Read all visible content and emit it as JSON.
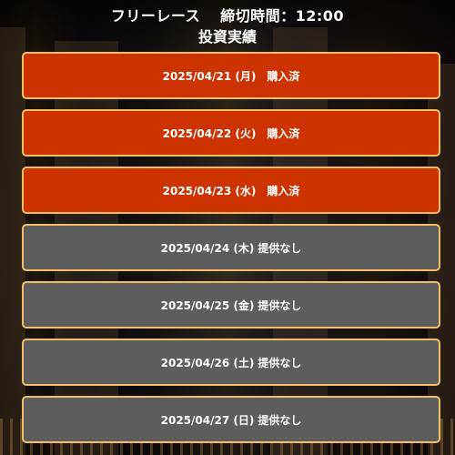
{
  "header": {
    "race_label": "フリーレース",
    "deadline_label": "締切時間：12:00",
    "subtitle": "投資実績"
  },
  "colors": {
    "purchased_bg": "#cc3300",
    "none_bg": "#5d5d5d",
    "border": "#f2c063"
  },
  "days": [
    {
      "date": "2025/04/21 (月)",
      "status": "購入済",
      "state": "purchased"
    },
    {
      "date": "2025/04/22 (火)",
      "status": "購入済",
      "state": "purchased"
    },
    {
      "date": "2025/04/23 (水)",
      "status": "購入済",
      "state": "purchased"
    },
    {
      "date": "2025/04/24 (木)",
      "status": "提供なし",
      "state": "none"
    },
    {
      "date": "2025/04/25 (金)",
      "status": "提供なし",
      "state": "none"
    },
    {
      "date": "2025/04/26 (土)",
      "status": "提供なし",
      "state": "none"
    },
    {
      "date": "2025/04/27 (日)",
      "status": "提供なし",
      "state": "none"
    }
  ]
}
